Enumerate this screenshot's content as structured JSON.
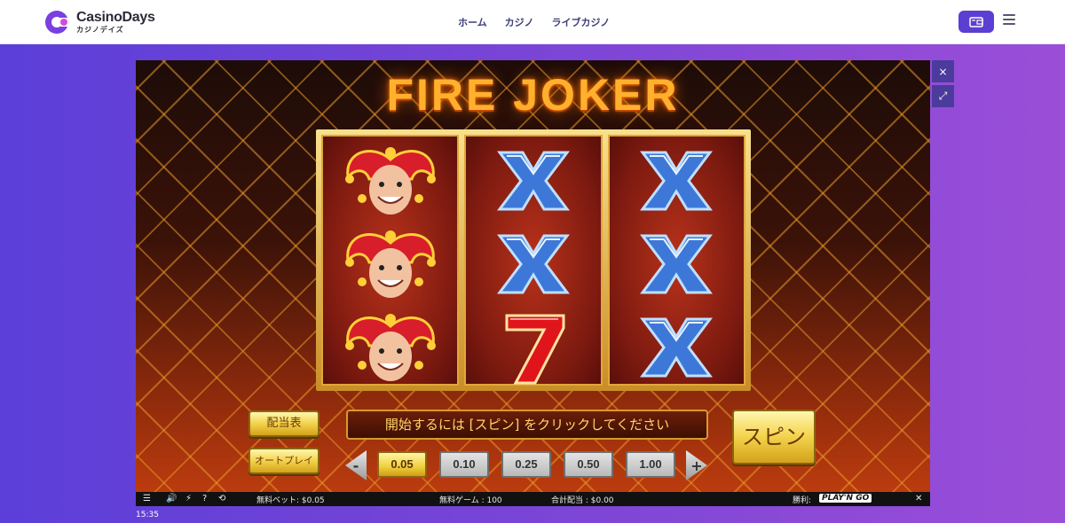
{
  "header": {
    "logo_name": "CasinoDays",
    "logo_sub": "カジノデイズ",
    "nav": [
      "ホーム",
      "カジノ",
      "ライブカジノ"
    ]
  },
  "game": {
    "title": "FIRE JOKER",
    "reels": [
      [
        "joker",
        "joker",
        "joker"
      ],
      [
        "x",
        "x",
        "7"
      ],
      [
        "x",
        "x",
        "x"
      ]
    ],
    "paytable_label": "配当表",
    "autoplay_label": "オートプレイ",
    "message": "開始するには [スピン] をクリックしてください",
    "spin_label": "スピン",
    "bets": [
      "0.05",
      "0.10",
      "0.25",
      "0.50",
      "1.00"
    ],
    "selected_bet": "0.05",
    "prev_bet": "-",
    "next_bet": "+",
    "side_close": "×",
    "side_expand": "⤢"
  },
  "status": {
    "bet": "無料ベット: $0.05",
    "free_games": "無料ゲーム : 100",
    "total_payout": "合計配当 : $0.00",
    "win": "勝利:",
    "provider": "PLAY'N GO",
    "close": "✕"
  },
  "clock": "15:35",
  "colors": {
    "brand": "#5a3fd2",
    "gold": "#f3d24b",
    "fire": "#ffb12e"
  }
}
